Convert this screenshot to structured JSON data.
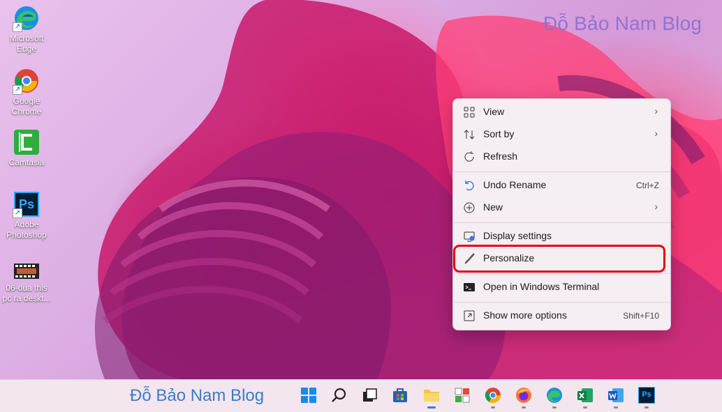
{
  "watermark": {
    "top": "Đỗ Bảo Nam Blog",
    "taskbar": "Đỗ Bảo Nam Blog"
  },
  "desktop_icons": [
    {
      "name": "microsoft-edge-icon",
      "label_line1": "Microsoft",
      "label_line2": "Edge"
    },
    {
      "name": "google-chrome-icon",
      "label_line1": "Google",
      "label_line2": "Chrome"
    },
    {
      "name": "camtasia-icon",
      "label_line1": "Camtasia",
      "label_line2": ""
    },
    {
      "name": "adobe-photoshop-icon",
      "label_line1": "Adobe",
      "label_line2": "Photoshop"
    },
    {
      "name": "video-file-icon",
      "label_line1": "06-dua this",
      "label_line2": "pc ra deskt..."
    }
  ],
  "photoshop_icon_text": "Ps",
  "context_menu": {
    "view": "View",
    "sort_by": "Sort by",
    "refresh": "Refresh",
    "undo_rename": "Undo Rename",
    "undo_rename_shortcut": "Ctrl+Z",
    "new": "New",
    "display_settings": "Display settings",
    "personalize": "Personalize",
    "open_terminal": "Open in Windows Terminal",
    "show_more": "Show more options",
    "show_more_shortcut": "Shift+F10",
    "chevron": "›"
  },
  "taskbar_apps": [
    "start",
    "search",
    "task-view",
    "microsoft-store",
    "file-explorer",
    "puzzle-app",
    "google-chrome",
    "firefox",
    "microsoft-edge",
    "excel",
    "word",
    "photoshop"
  ],
  "colors": {
    "highlight_border": "#e8000b",
    "watermark_top": "#8c6fd0",
    "watermark_taskbar": "#3b7cc9"
  }
}
